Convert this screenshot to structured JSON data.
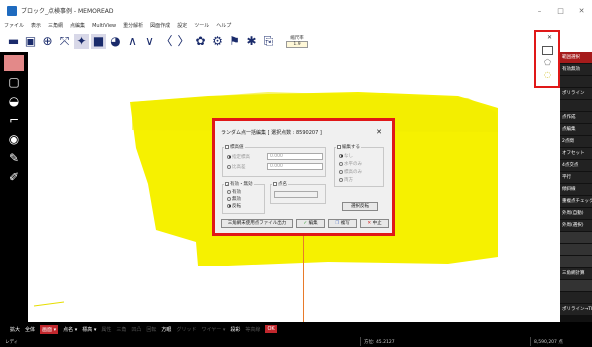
{
  "app": {
    "title": "ブロック_点検事例 - MEMOREAD"
  },
  "window": {
    "minimize": "–",
    "maximize": "□",
    "close": "✕"
  },
  "menu": [
    "ファイル",
    "表示",
    "三角網",
    "点編集",
    "MultiView",
    "重分解析",
    "図面作成",
    "設定",
    "ツール",
    "ヘルプ"
  ],
  "zoom": {
    "label": "縮尺率",
    "value": "1.9"
  },
  "float_toolbox": {
    "close": "✕"
  },
  "dialog": {
    "title": "ランダム点一括編集 [ 選択点数 : 8590207 ]",
    "close": "✕",
    "elevation_group": "標高値",
    "elevation_options": [
      "指定標高",
      "比高差"
    ],
    "elevation_values": [
      "0.000",
      "0.000"
    ],
    "edit_group": "編集する",
    "edit_options": [
      "なし",
      "水平のみ",
      "標高のみ",
      "両方"
    ],
    "enabled_group": "有効・無効",
    "enabled_options": [
      "有効",
      "無効",
      "反転"
    ],
    "pointname_group": "点名",
    "select_invert": "選択反転",
    "output_button": "三角網未使用点ファイル出力",
    "edit_button": "編集",
    "copy_button": "複写",
    "cancel_button": "中止"
  },
  "right_panel": [
    {
      "label": "範囲選択",
      "style": "red"
    },
    {
      "label": "有効無効",
      "style": ""
    },
    {
      "label": "",
      "style": ""
    },
    {
      "label": "ポリライン",
      "style": ""
    },
    {
      "label": "",
      "style": ""
    },
    {
      "label": "点作成",
      "style": ""
    },
    {
      "label": "点編集",
      "style": ""
    },
    {
      "label": "2点間",
      "style": ""
    },
    {
      "label": "オフセット",
      "style": ""
    },
    {
      "label": "4点交点",
      "style": ""
    },
    {
      "label": "平行",
      "style": ""
    },
    {
      "label": "傾斜線",
      "style": ""
    },
    {
      "label": "重複点チェック",
      "style": ""
    },
    {
      "label": "外周(自動)",
      "style": ""
    },
    {
      "label": "外周(選択)",
      "style": ""
    },
    {
      "label": "",
      "style": "dark"
    },
    {
      "label": "",
      "style": "dark"
    },
    {
      "label": "",
      "style": "dark"
    },
    {
      "label": "三角網計算",
      "style": ""
    },
    {
      "label": "",
      "style": "dark"
    },
    {
      "label": "",
      "style": ""
    },
    {
      "label": "ポリライン→TIN変換",
      "style": ""
    },
    {
      "label": "重複削除",
      "style": ""
    }
  ],
  "bottom_toolbar": [
    {
      "label": "拡大",
      "style": ""
    },
    {
      "label": "全体",
      "style": ""
    },
    {
      "label": "画面 ▾",
      "style": "red"
    },
    {
      "label": "点名 ▾",
      "style": ""
    },
    {
      "label": "標高 ▾",
      "style": ""
    },
    {
      "label": "属性",
      "style": "dim"
    },
    {
      "label": "三角",
      "style": "dim"
    },
    {
      "label": "凹凸",
      "style": "dim"
    },
    {
      "label": "回転",
      "style": "dim"
    },
    {
      "label": "方眼",
      "style": ""
    },
    {
      "label": "グリッド",
      "style": "dim"
    },
    {
      "label": "ワイヤー ▾",
      "style": "dim"
    },
    {
      "label": "段彩",
      "style": ""
    },
    {
      "label": "等高線",
      "style": "dim"
    },
    {
      "label": "OK",
      "style": "red"
    }
  ],
  "status": {
    "mode": "レディ",
    "direction": "方位: 45.2127",
    "count": "8,590,207 点"
  }
}
